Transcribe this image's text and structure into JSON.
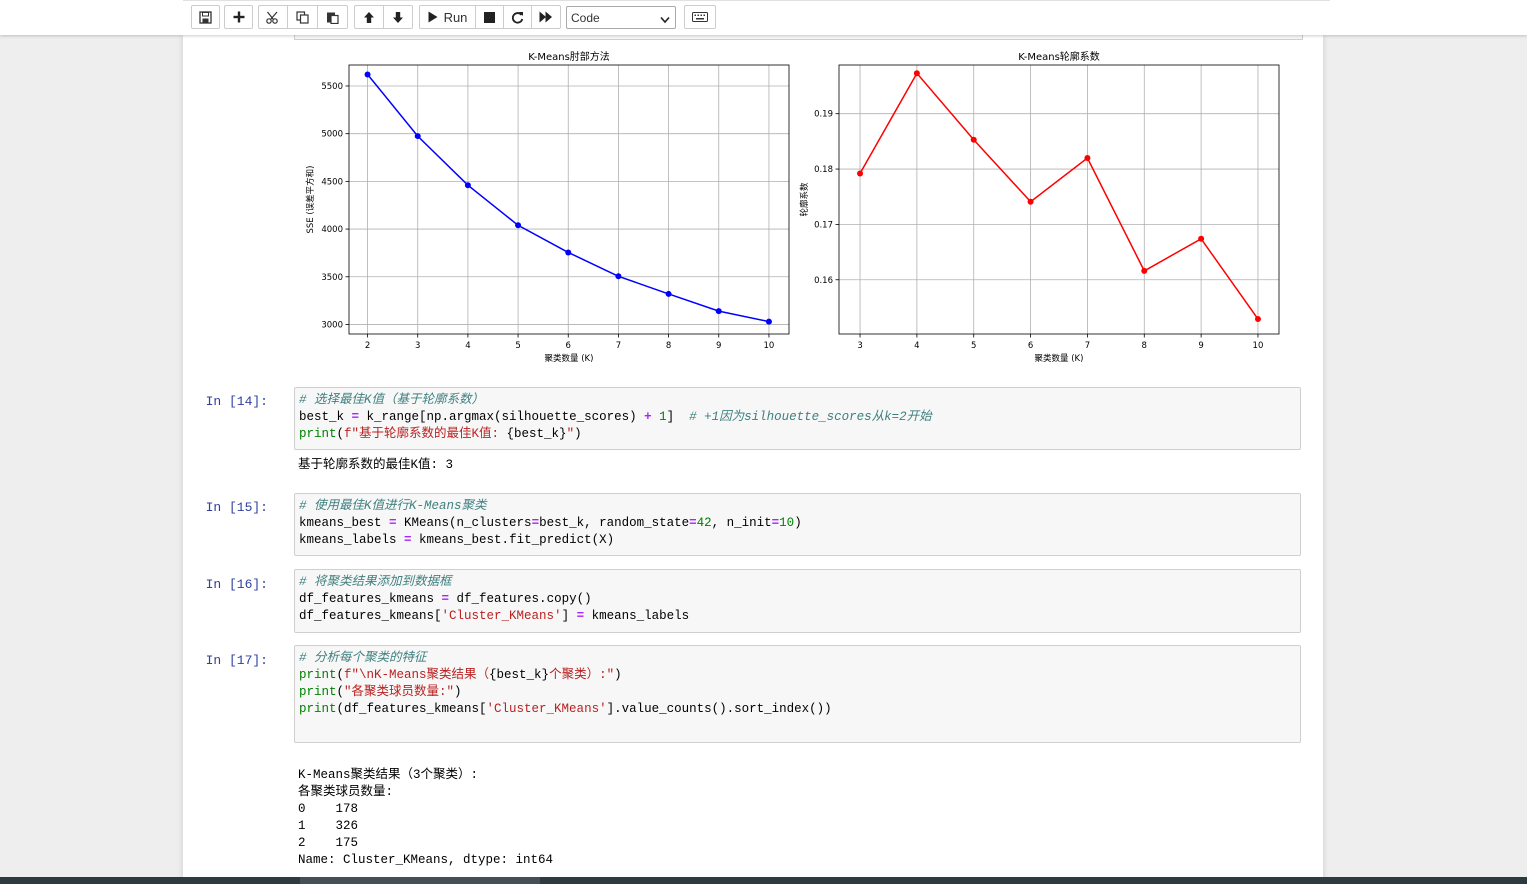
{
  "toolbar": {
    "run_label": "Run",
    "cell_type": "Code"
  },
  "icons": [
    "save-icon",
    "plus-icon",
    "cut-icon",
    "copy-icon",
    "paste-icon",
    "arrow-up-icon",
    "arrow-down-icon",
    "play-icon",
    "stop-icon",
    "restart-icon",
    "fast-forward-icon",
    "keyboard-icon"
  ],
  "colors": {
    "prompt": "#303f9f",
    "comment": "#408080",
    "keyword": "#aa22ff",
    "builtin": "#008000",
    "string": "#ba2121",
    "series_sse": "#0000ff",
    "series_silhouette": "#ff0000"
  },
  "chart_data": [
    {
      "type": "line",
      "title": "K-Means肘部方法",
      "xlabel": "聚类数量 (K)",
      "ylabel": "SSE (误差平方和)",
      "x": [
        2,
        3,
        4,
        5,
        6,
        7,
        8,
        9,
        10
      ],
      "xticks": [
        "2",
        "3",
        "4",
        "5",
        "6",
        "7",
        "8",
        "9",
        "10"
      ],
      "yticks": [
        "3000",
        "3500",
        "4000",
        "4500",
        "5000",
        "5500"
      ],
      "ylim": [
        2900,
        5720
      ],
      "values": [
        5620,
        4975,
        4460,
        4040,
        3755,
        3505,
        3320,
        3140,
        3030
      ],
      "grid": true,
      "color": "#0000ff"
    },
    {
      "type": "line",
      "title": "K-Means轮廓系数",
      "xlabel": "聚类数量 (K)",
      "ylabel": "轮廓系数",
      "x": [
        3,
        4,
        5,
        6,
        7,
        8,
        9,
        10
      ],
      "xticks": [
        "3",
        "4",
        "5",
        "6",
        "7",
        "8",
        "9",
        "10"
      ],
      "yticks": [
        "0.16",
        "0.17",
        "0.18",
        "0.19"
      ],
      "ylim": [
        0.1502,
        0.1988
      ],
      "values": [
        0.1792,
        0.1973,
        0.1853,
        0.1741,
        0.182,
        0.1616,
        0.1674,
        0.1529
      ],
      "grid": true,
      "color": "#ff0000"
    }
  ],
  "cells": [
    {
      "prompt": "In  [14]:",
      "lines": [
        [
          {
            "c": "cm",
            "t": "# 选择最佳K值（基于轮廓系数）"
          }
        ],
        [
          {
            "c": "",
            "t": "best_k "
          },
          {
            "c": "op",
            "t": "="
          },
          {
            "c": "",
            "t": " k_range[np.argmax(silhouette_scores) "
          },
          {
            "c": "op",
            "t": "+"
          },
          {
            "c": "",
            "t": " "
          },
          {
            "c": "nu",
            "t": "1"
          },
          {
            "c": "",
            "t": "]  "
          },
          {
            "c": "cm",
            "t": "# +1因为silhouette_scores从k=2开始"
          }
        ],
        [
          {
            "c": "nb",
            "t": "print"
          },
          {
            "c": "",
            "t": "("
          },
          {
            "c": "st",
            "t": "f\"基于轮廓系数的最佳K值: "
          },
          {
            "c": "",
            "t": "{best_k}"
          },
          {
            "c": "st",
            "t": "\""
          },
          {
            "c": "",
            "t": ")"
          }
        ]
      ],
      "output": "基于轮廓系数的最佳K值: 3"
    },
    {
      "prompt": "In  [15]:",
      "lines": [
        [
          {
            "c": "cm",
            "t": "# 使用最佳K值进行K-Means聚类"
          }
        ],
        [
          {
            "c": "",
            "t": "kmeans_best "
          },
          {
            "c": "op",
            "t": "="
          },
          {
            "c": "",
            "t": " KMeans(n_clusters"
          },
          {
            "c": "op",
            "t": "="
          },
          {
            "c": "",
            "t": "best_k, random_state"
          },
          {
            "c": "op",
            "t": "="
          },
          {
            "c": "nu",
            "t": "42"
          },
          {
            "c": "",
            "t": ", n_init"
          },
          {
            "c": "op",
            "t": "="
          },
          {
            "c": "nu",
            "t": "10"
          },
          {
            "c": "",
            "t": ")"
          }
        ],
        [
          {
            "c": "",
            "t": "kmeans_labels "
          },
          {
            "c": "op",
            "t": "="
          },
          {
            "c": "",
            "t": " kmeans_best.fit_predict(X)"
          }
        ]
      ]
    },
    {
      "prompt": "In  [16]:",
      "lines": [
        [
          {
            "c": "cm",
            "t": "# 将聚类结果添加到数据框"
          }
        ],
        [
          {
            "c": "",
            "t": "df_features_kmeans "
          },
          {
            "c": "op",
            "t": "="
          },
          {
            "c": "",
            "t": " df_features.copy()"
          }
        ],
        [
          {
            "c": "",
            "t": "df_features_kmeans["
          },
          {
            "c": "st",
            "t": "'Cluster_KMeans'"
          },
          {
            "c": "",
            "t": "] "
          },
          {
            "c": "op",
            "t": "="
          },
          {
            "c": "",
            "t": " kmeans_labels"
          }
        ]
      ]
    },
    {
      "prompt": "In  [17]:",
      "lines": [
        [
          {
            "c": "cm",
            "t": "# 分析每个聚类的特征"
          }
        ],
        [
          {
            "c": "nb",
            "t": "print"
          },
          {
            "c": "",
            "t": "("
          },
          {
            "c": "st",
            "t": "f\"\\nK-Means聚类结果（"
          },
          {
            "c": "",
            "t": "{best_k}"
          },
          {
            "c": "st",
            "t": "个聚类）:\""
          },
          {
            "c": "",
            "t": ")"
          }
        ],
        [
          {
            "c": "nb",
            "t": "print"
          },
          {
            "c": "",
            "t": "("
          },
          {
            "c": "st",
            "t": "\"各聚类球员数量:\""
          },
          {
            "c": "",
            "t": ")"
          }
        ],
        [
          {
            "c": "nb",
            "t": "print"
          },
          {
            "c": "",
            "t": "(df_features_kmeans["
          },
          {
            "c": "st",
            "t": "'Cluster_KMeans'"
          },
          {
            "c": "",
            "t": "].value_counts().sort_index())"
          }
        ]
      ],
      "output_lines": [
        "K-Means聚类结果（3个聚类）:",
        "各聚类球员数量:",
        "0    178",
        "1    326",
        "2    175",
        "Name: Cluster_KMeans, dtype: int64"
      ]
    }
  ]
}
